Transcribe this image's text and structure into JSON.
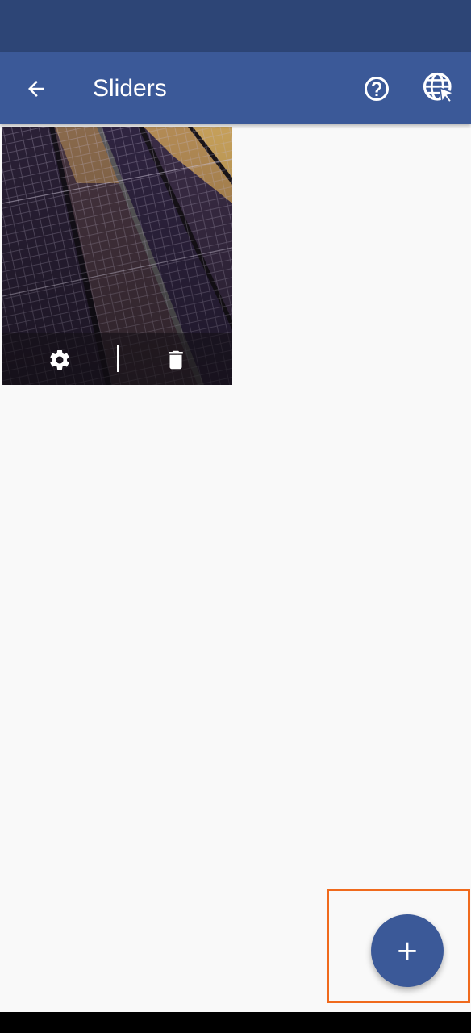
{
  "app_bar": {
    "title": "Sliders",
    "back_icon": "arrow-back-icon",
    "help_icon": "help-circle-icon",
    "web_icon": "globe-cursor-icon"
  },
  "slides": [
    {
      "image": "solar-panels-photo",
      "actions": {
        "settings_icon": "gear-icon",
        "delete_icon": "trash-icon"
      }
    }
  ],
  "fab": {
    "label": "+",
    "icon": "plus-icon"
  },
  "colors": {
    "status_bar": "#2d4576",
    "primary": "#3b5998",
    "background": "#f9f9f9",
    "highlight": "#f06a1d"
  }
}
